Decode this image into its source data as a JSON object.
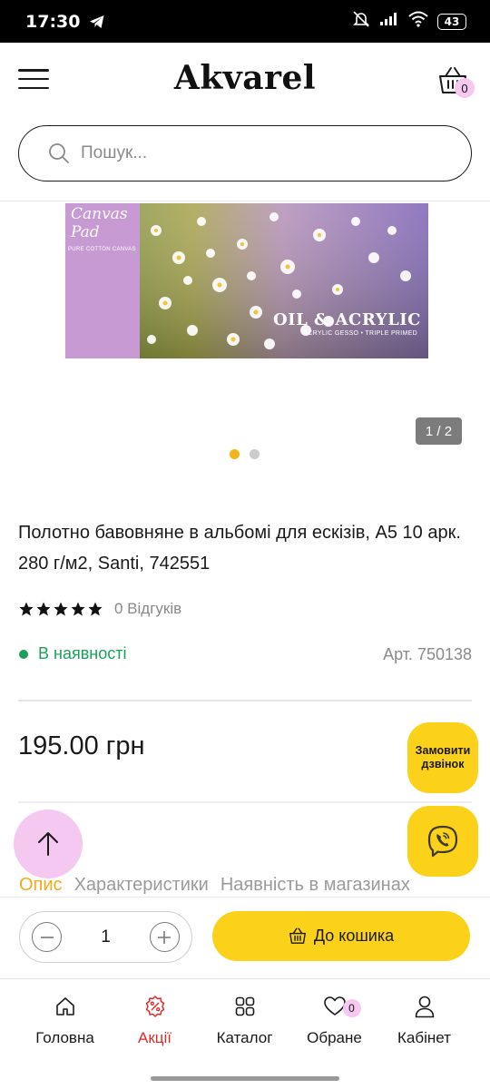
{
  "status_bar": {
    "time": "17:30",
    "battery": "43"
  },
  "header": {
    "logo": "Akvarel",
    "cart_count": "0"
  },
  "search": {
    "placeholder": "Пошук..."
  },
  "gallery": {
    "image": {
      "pad_title": "Canvas Pad",
      "pad_subtitle": "PURE COTTON CANVAS",
      "overlay_title": "OIL & ACRYLIC",
      "overlay_subtitle": "ACRYLIC GESSO • TRIPLE PRIMED"
    },
    "counter": "1 / 2",
    "slides": 2,
    "active_slide": 1
  },
  "product": {
    "title": "Полотно бавовняне в альбомі для ескізів, А5 10 арк. 280 г/м2, Santi, 742551",
    "rating_stars": 5,
    "reviews": "0 Відгуків",
    "availability": "В наявності",
    "sku": "Арт. 750138",
    "price": "195.00 грн"
  },
  "callback_button": {
    "label": "Замовити дзвінок"
  },
  "tabs": [
    {
      "label": "Опис",
      "active": true
    },
    {
      "label": "Характеристики",
      "active": false
    },
    {
      "label": "Наявність в магазинах",
      "active": false
    }
  ],
  "cart_row": {
    "quantity": "1",
    "add_label": "До кошика"
  },
  "bottom_nav": {
    "home": "Головна",
    "sale": "Акції",
    "catalog": "Каталог",
    "favorites": "Обране",
    "favorites_count": "0",
    "account": "Кабінет"
  },
  "colors": {
    "accent_yellow": "#fcd119",
    "active_orange": "#f4a91a",
    "in_stock_green": "#18a058",
    "sale_red": "#e02a2a",
    "badge_pink": "#f7c7f0"
  }
}
